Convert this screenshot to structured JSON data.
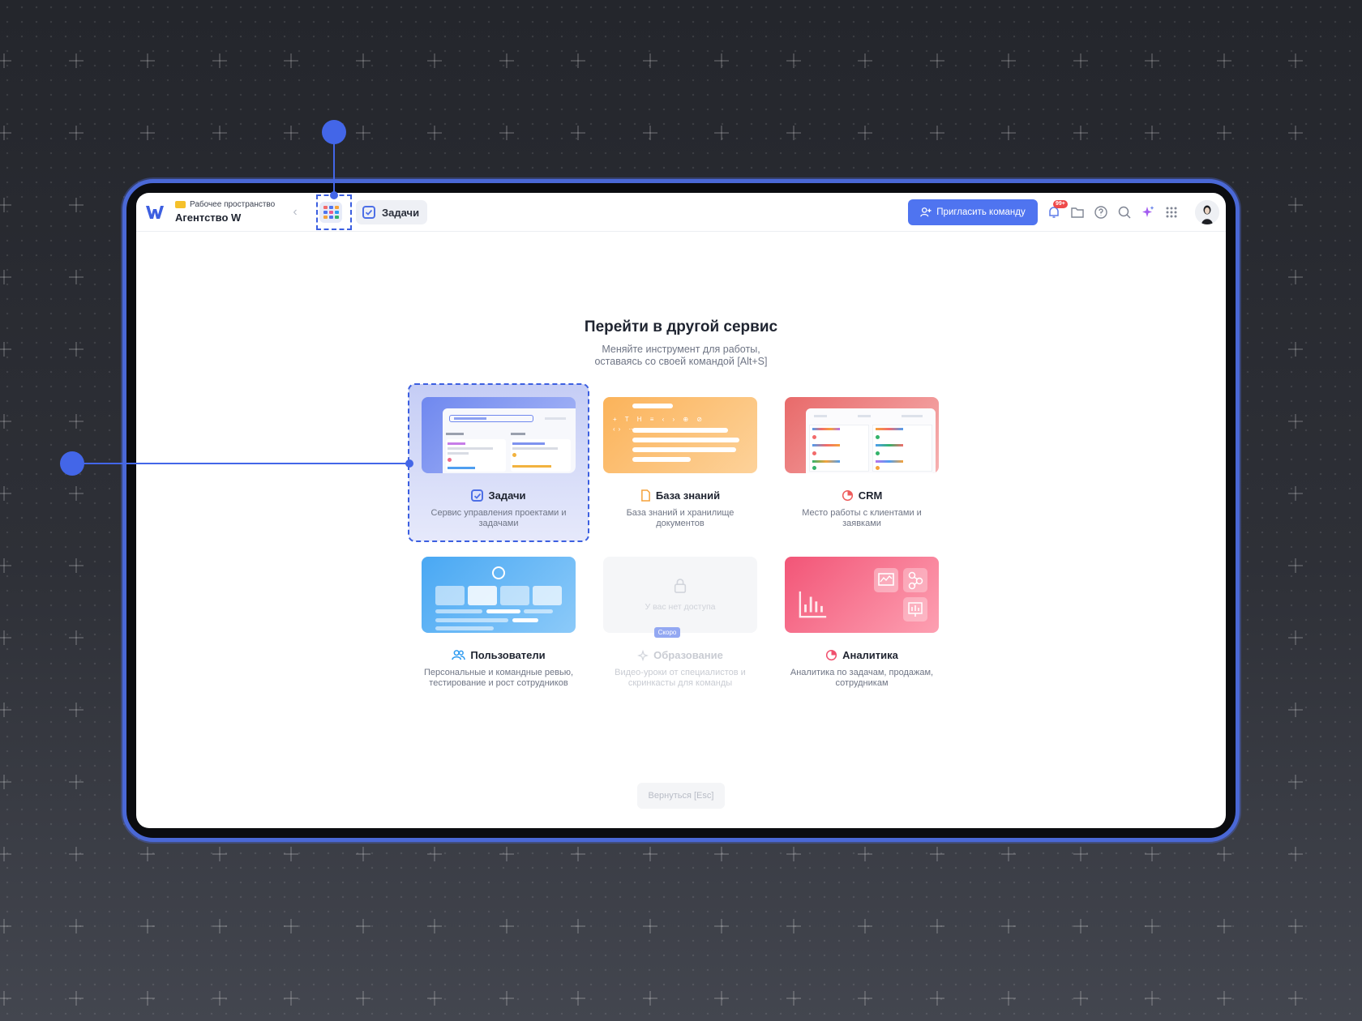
{
  "workspace": {
    "badge": "",
    "label": "Рабочее пространство",
    "name": "Агентство W"
  },
  "topbar": {
    "active_tab": "Задачи",
    "invite_label": "Пригласить команду",
    "notifications_count": "99+",
    "icons": [
      "bell-icon",
      "folder-icon",
      "help-icon",
      "search-icon",
      "sparkle-icon",
      "apps-grid-icon"
    ]
  },
  "main": {
    "title": "Перейти в другой сервис",
    "subtitle_line1": "Меняйте инструмент для работы,",
    "subtitle_line2": "оставаясь со своей командой [Alt+S]",
    "services": [
      {
        "name": "Задачи",
        "desc": "Сервис управления проектами и задачами",
        "icon": "checkbox-icon",
        "accent": "#4d6fe6",
        "state": "selected"
      },
      {
        "name": "База знаний",
        "desc": "База знаний и хранилище документов",
        "icon": "document-icon",
        "accent": "#f5a23a",
        "state": "normal"
      },
      {
        "name": "CRM",
        "desc": "Место работы с клиентами и заявками",
        "icon": "crm-icon",
        "accent": "#ee5b5b",
        "state": "normal"
      },
      {
        "name": "Пользователи",
        "desc": "Персональные и командные ревью, тестирование и рост сотрудников",
        "icon": "users-icon",
        "accent": "#2f9bf0",
        "state": "normal"
      },
      {
        "name": "Образование",
        "desc": "Видео-уроки от специалистов и скринкасты для команды",
        "icon": "education-icon",
        "accent": "#c9ccd3",
        "state": "disabled",
        "locked_text": "У вас нет доступа",
        "soon_badge": "Скоро"
      },
      {
        "name": "Аналитика",
        "desc": "Аналитика по задачам, продажам, сотрудникам",
        "icon": "analytics-icon",
        "accent": "#f0506e",
        "state": "normal"
      }
    ],
    "back_label": "Вернуться [Esc]"
  }
}
